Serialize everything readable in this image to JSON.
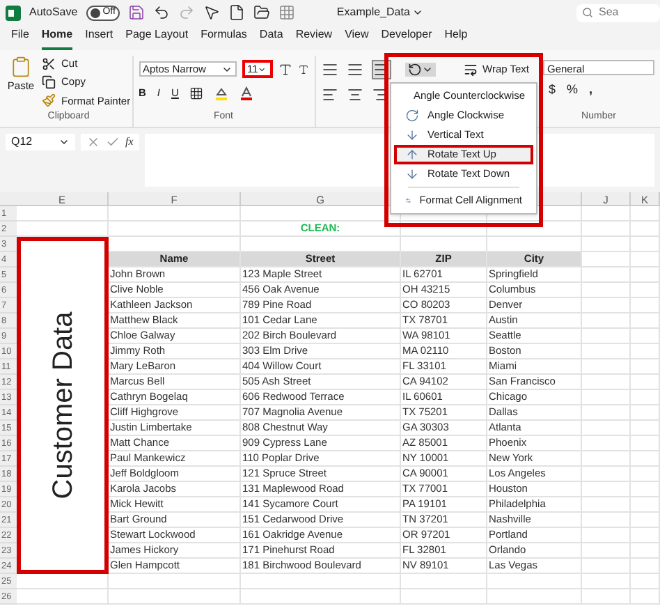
{
  "title_bar": {
    "autosave_label": "AutoSave",
    "autosave_toggle": {
      "label": "Off",
      "on": false
    },
    "file_name": "Example_Data",
    "search_placeholder": "Sea"
  },
  "menu_tabs": [
    {
      "label": "File",
      "selected": false
    },
    {
      "label": "Home",
      "selected": true
    },
    {
      "label": "Insert",
      "selected": false
    },
    {
      "label": "Page Layout",
      "selected": false
    },
    {
      "label": "Formulas",
      "selected": false
    },
    {
      "label": "Data",
      "selected": false
    },
    {
      "label": "Review",
      "selected": false
    },
    {
      "label": "View",
      "selected": false
    },
    {
      "label": "Developer",
      "selected": false
    },
    {
      "label": "Help",
      "selected": false
    }
  ],
  "ribbon": {
    "clipboard": {
      "paste": "Paste",
      "cut": "Cut",
      "copy": "Copy",
      "format_painter": "Format Painter",
      "label": "Clipboard"
    },
    "font": {
      "name": "Aptos Narrow",
      "size": "11",
      "bold": "B",
      "italic": "I",
      "underline": "U",
      "label": "Font"
    },
    "alignment": {
      "wrap_text": "Wrap Text"
    },
    "number": {
      "format": "General",
      "currency": "$",
      "percent": "%",
      "comma": ",",
      "label": "Number"
    }
  },
  "orientation_menu": {
    "items": [
      {
        "label": "Angle Counterclockwise",
        "selected": false
      },
      {
        "label": "Angle Clockwise",
        "selected": false
      },
      {
        "label": "Vertical Text",
        "selected": false
      },
      {
        "label": "Rotate Text Up",
        "selected": true
      },
      {
        "label": "Rotate Text Down",
        "selected": false
      },
      {
        "label": "Format Cell Alignment",
        "selected": false
      }
    ]
  },
  "formula_bar": {
    "name_box": "Q12",
    "function_label": "fx"
  },
  "sheet": {
    "columns": [
      {
        "label": "E"
      },
      {
        "label": "F"
      },
      {
        "label": "G"
      },
      {
        "label": "J"
      },
      {
        "label": "K"
      }
    ],
    "rows": [
      "1",
      "2",
      "3",
      "4",
      "5",
      "6",
      "7",
      "8",
      "9",
      "10",
      "11",
      "12",
      "13",
      "14",
      "15",
      "16",
      "17",
      "18",
      "19",
      "20",
      "21",
      "22",
      "23",
      "24",
      "25",
      "26"
    ],
    "section_title": "CLEAN:",
    "rotated_label": "Customer Data",
    "table_headers": [
      "Name",
      "Street",
      "ZIP",
      "City"
    ],
    "table_rows": [
      [
        "John Brown",
        "123 Maple Street",
        "IL 62701",
        "Springfield"
      ],
      [
        "Clive Noble",
        "456 Oak Avenue",
        "OH 43215",
        "Columbus"
      ],
      [
        "Kathleen Jackson",
        "789 Pine Road",
        "CO 80203",
        "Denver"
      ],
      [
        "Matthew Black",
        "101 Cedar Lane",
        "TX 78701",
        "Austin"
      ],
      [
        "Chloe Galway",
        "202 Birch Boulevard",
        "WA 98101",
        "Seattle"
      ],
      [
        "Jimmy Roth",
        "303 Elm Drive",
        "MA 02110",
        "Boston"
      ],
      [
        "Mary LeBaron",
        "404 Willow Court",
        "FL 33101",
        "Miami"
      ],
      [
        "Marcus Bell",
        "505 Ash Street",
        "CA 94102",
        "San Francisco"
      ],
      [
        "Cathryn Bogelaq",
        "606 Redwood Terrace",
        "IL 60601",
        "Chicago"
      ],
      [
        "Cliff Highgrove",
        "707 Magnolia Avenue",
        "TX 75201",
        "Dallas"
      ],
      [
        "Justin Limbertake",
        "808 Chestnut Way",
        "GA 30303",
        "Atlanta"
      ],
      [
        "Matt Chance",
        "909 Cypress Lane",
        "AZ 85001",
        "Phoenix"
      ],
      [
        "Paul Mankewicz",
        "110 Poplar Drive",
        "NY 10001",
        "New York"
      ],
      [
        "Jeff Boldgloom",
        "121 Spruce Street",
        "CA 90001",
        "Los Angeles"
      ],
      [
        "Karola Jacobs",
        "131 Maplewood Road",
        "TX 77001",
        "Houston"
      ],
      [
        "Mick Hewitt",
        "141 Sycamore Court",
        "PA 19101",
        "Philadelphia"
      ],
      [
        "Bart Ground",
        "151 Cedarwood Drive",
        "TN 37201",
        "Nashville"
      ],
      [
        "Stewart Lockwood",
        "161 Oakridge Avenue",
        "OR 97201",
        "Portland"
      ],
      [
        "James Hickory",
        "171 Pinehurst Road",
        "FL 32801",
        "Orlando"
      ],
      [
        "Glen Hampcott",
        "181 Birchwood Boulevard",
        "NV 89101",
        "Las Vegas"
      ]
    ]
  }
}
